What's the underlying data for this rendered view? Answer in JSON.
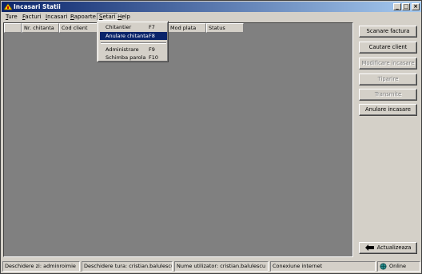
{
  "window": {
    "title": "Incasari Statii",
    "controls": {
      "minimize": "_",
      "maximize": "□",
      "close": "×"
    }
  },
  "menu": {
    "items": [
      {
        "first": "T",
        "rest": "ure"
      },
      {
        "first": "F",
        "rest": "acturi"
      },
      {
        "first": "I",
        "rest": "ncasari"
      },
      {
        "first": "R",
        "rest": "apoarte"
      },
      {
        "first": "S",
        "rest": "etari"
      },
      {
        "first": "H",
        "rest": "elp"
      }
    ]
  },
  "dropdown": {
    "items": [
      {
        "label": "Chitantier",
        "shortcut": "F7"
      },
      {
        "label": "Anulare chitanta",
        "shortcut": "F8"
      },
      {
        "label": "Administrare",
        "shortcut": "F9"
      },
      {
        "label": "Schimba parola",
        "shortcut": "F10"
      }
    ]
  },
  "grid": {
    "columns": [
      "",
      "Nr. chitanta",
      "Cod client",
      "",
      "",
      "",
      "Mod plata",
      "Status"
    ]
  },
  "actions": {
    "scan_invoice": "Scanare factura",
    "search_client": "Cautare client",
    "modify_payment": "Modificare incasare",
    "print": "Tiparire",
    "transmit": "Transmite",
    "cancel_payment": "Anulare incasare",
    "refresh": "Actualizeaza"
  },
  "status": {
    "day_open": "Deschidere zi: adminroimie",
    "shift_open": "Deschidere tura: cristian.balulescu",
    "user": "Nume utilizator: cristian.balulescu",
    "connection": "Conexiune internet",
    "online": "Online"
  },
  "colors": {
    "titlebar_start": "#0a246a",
    "titlebar_end": "#a6caf0",
    "menu_highlight": "#0a246a",
    "grid_background": "#808080",
    "face": "#d4d0c8"
  }
}
